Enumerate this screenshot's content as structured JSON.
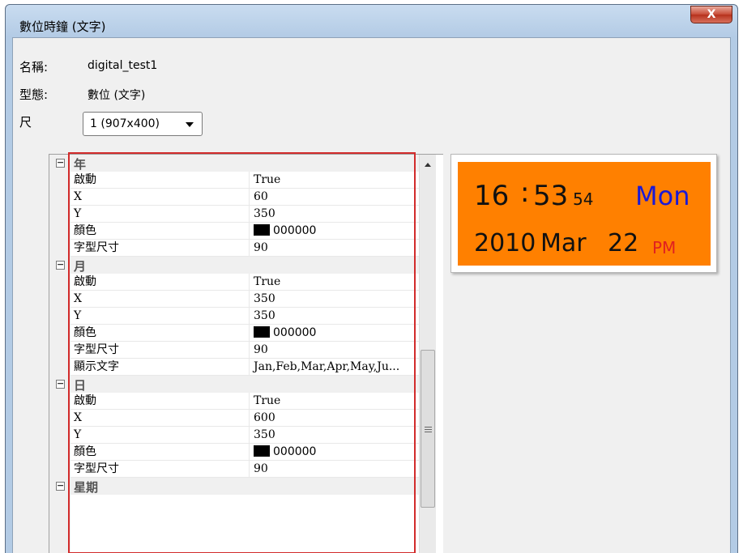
{
  "window": {
    "title": "數位時鐘 (文字)",
    "close_label": "X"
  },
  "info": {
    "name_label": "名稱:",
    "name_value": "digital_test1",
    "type_label": "型態:",
    "type_value": "數位 (文字)",
    "size_label": "尺",
    "size_selected": "1  (907x400)"
  },
  "grid": {
    "categories": [
      {
        "name": "年",
        "toggle": "−",
        "props": [
          {
            "name": "啟動",
            "value": "True"
          },
          {
            "name": "X",
            "value": "60"
          },
          {
            "name": "Y",
            "value": "350"
          },
          {
            "name": "顏色",
            "value": "000000",
            "color": "#000000"
          },
          {
            "name": "字型尺寸",
            "value": "90"
          }
        ]
      },
      {
        "name": "月",
        "toggle": "−",
        "props": [
          {
            "name": "啟動",
            "value": "True"
          },
          {
            "name": "X",
            "value": "350"
          },
          {
            "name": "Y",
            "value": "350"
          },
          {
            "name": "顏色",
            "value": "000000",
            "color": "#000000"
          },
          {
            "name": "字型尺寸",
            "value": "90"
          },
          {
            "name": "顯示文字",
            "value": "Jan,Feb,Mar,Apr,May,Ju..."
          }
        ]
      },
      {
        "name": "日",
        "toggle": "−",
        "props": [
          {
            "name": "啟動",
            "value": "True"
          },
          {
            "name": "X",
            "value": "600"
          },
          {
            "name": "Y",
            "value": "350"
          },
          {
            "name": "顏色",
            "value": "000000",
            "color": "#000000"
          },
          {
            "name": "字型尺寸",
            "value": "90"
          }
        ]
      },
      {
        "name": "星期",
        "toggle": "−",
        "props": []
      }
    ]
  },
  "preview": {
    "background": "#ff8000",
    "hour": "16",
    "separator": ":",
    "minute": "53",
    "second": "54",
    "weekday": "Mon",
    "year": "2010",
    "month": "Mar",
    "day": "22",
    "ampm": "PM",
    "weekday_color": "#1a1ad6",
    "ampm_color": "#e02020"
  }
}
